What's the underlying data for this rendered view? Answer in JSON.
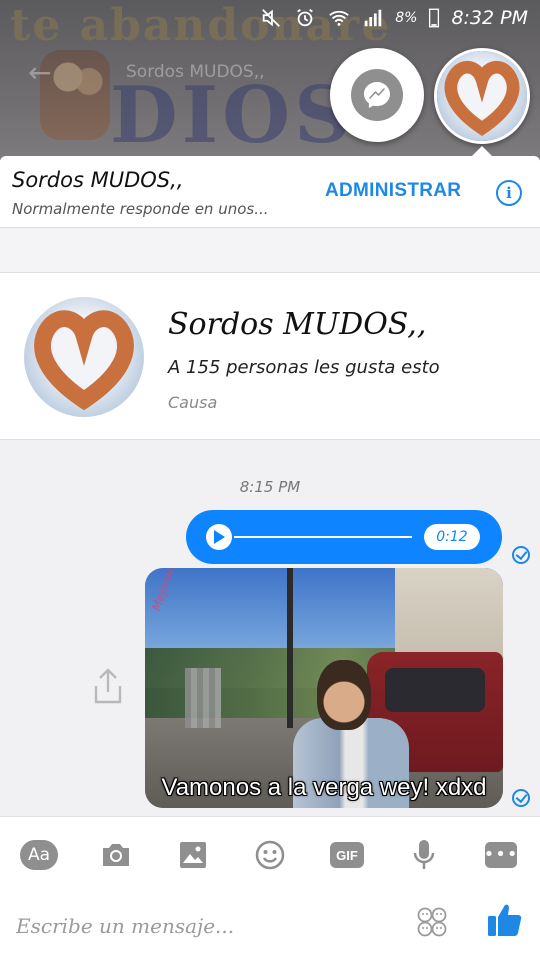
{
  "wallpaper": {
    "banner_text": "te abandonare",
    "dios_text": "DIOS",
    "blur_title": "Sordos MUDOS,,"
  },
  "status_bar": {
    "battery_percent": "8%",
    "time": "8:32 PM",
    "icons": [
      "mute-icon",
      "alarm-icon",
      "wifi-icon",
      "signal-icon",
      "battery-icon"
    ]
  },
  "chat_header": {
    "name": "Sordos MUDOS,,",
    "subtitle": "Normalmente responde en unos...",
    "manage_label": "ADMINISTRAR",
    "info_glyph": "i"
  },
  "page_card": {
    "name": "Sordos MUDOS,,",
    "likes": "A 155 personas les gusta esto",
    "category": "Causa"
  },
  "conversation": {
    "timestamp": "8:15 PM",
    "audio_message": {
      "duration": "0:12"
    },
    "image_message": {
      "caption": "Vamonos a la verga wey! xdxd",
      "watermark": "Mejorando"
    }
  },
  "composer": {
    "aa_label": "Aa",
    "gif_label": "GIF",
    "more_label": "•••",
    "placeholder": "Escribe un mensaje..."
  },
  "colors": {
    "accent": "#1e88e5",
    "bubble": "#0f84ff",
    "icon_gray": "#8f8f8f"
  }
}
